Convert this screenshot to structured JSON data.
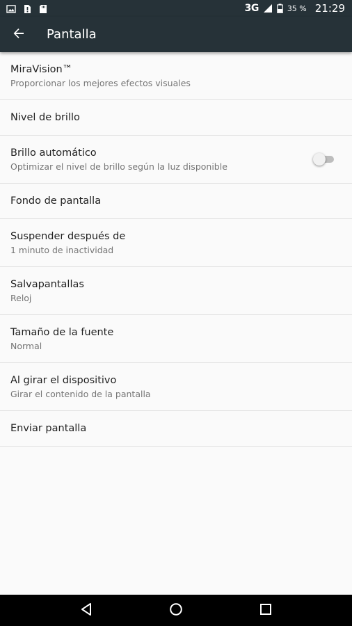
{
  "status_bar": {
    "network": "3G",
    "battery_percent": "35 %",
    "time": "21:29",
    "icons": [
      "image-notification-icon",
      "alert-notification-icon",
      "sd-card-icon",
      "signal-icon",
      "battery-icon"
    ]
  },
  "toolbar": {
    "title": "Pantalla",
    "back_icon": "arrow-back-icon"
  },
  "settings": {
    "items": [
      {
        "title": "MiraVision™",
        "subtitle": "Proporcionar los mejores efectos visuales"
      },
      {
        "title": "Nivel de brillo"
      },
      {
        "title": "Brillo automático",
        "subtitle": "Optimizar el nivel de brillo según la luz disponible",
        "toggle": false
      },
      {
        "title": "Fondo de pantalla"
      },
      {
        "title": "Suspender después de",
        "subtitle": "1 minuto de inactividad"
      },
      {
        "title": "Salvapantallas",
        "subtitle": "Reloj"
      },
      {
        "title": "Tamaño de la fuente",
        "subtitle": "Normal"
      },
      {
        "title": "Al girar el dispositivo",
        "subtitle": "Girar el contenido de la pantalla"
      },
      {
        "title": "Enviar pantalla"
      }
    ]
  },
  "nav_bar": {
    "icons": [
      "nav-back-icon",
      "nav-home-icon",
      "nav-recents-icon"
    ]
  },
  "colors": {
    "toolbar_bg": "#263238",
    "list_bg": "#fafafa",
    "divider": "#e0e0e0",
    "primary_text": "#212121",
    "secondary_text": "#757575"
  }
}
